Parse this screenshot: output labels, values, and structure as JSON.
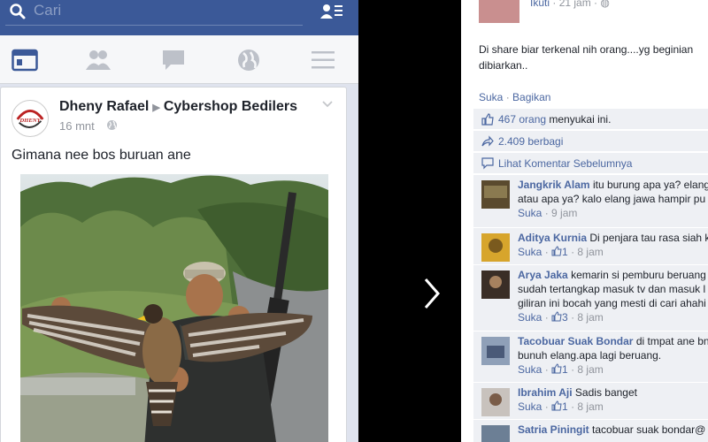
{
  "left": {
    "search": {
      "placeholder": "Cari"
    },
    "post": {
      "author": "Dheny Rafael",
      "target": "Cybershop Bedilers",
      "time": "16 mnt",
      "text": "Gimana nee bos buruan ane",
      "avatar_text": "DHENY"
    }
  },
  "right": {
    "header": {
      "poster": "Ikuti",
      "time": "21 jam"
    },
    "text": "Di share biar terkenal nih orang....yg beginian dibiarkan..",
    "actions": {
      "like": "Suka",
      "share": "Bagikan"
    },
    "likes": {
      "count": "467 orang",
      "suffix": "menyukai ini."
    },
    "shares": "2.409 berbagi",
    "previous": "Lihat Komentar Sebelumnya",
    "comments": [
      {
        "name": "Jangkrik Alam",
        "text": "itu burung apa ya? elang",
        "text2": "atau apa ya? kalo elang jawa hampir pu",
        "text3": "",
        "likes": "",
        "time": "9 jam"
      },
      {
        "name": "Aditya Kurnia",
        "text": "Di penjara tau rasa siah k",
        "text2": "",
        "text3": "",
        "likes": "1",
        "time": "8 jam"
      },
      {
        "name": "Arya Jaka",
        "text": "kemarin si pemburu beruang",
        "text2": "sudah tertangkap masuk tv dan masuk l",
        "text3": "giliran ini bocah yang mesti di cari ahahi",
        "likes": "3",
        "time": "8 jam"
      },
      {
        "name": "Tacobuar Suak Bondar",
        "text": "di tmpat ane bng",
        "text2": "bunuh elang.apa lagi beruang.",
        "text3": "",
        "likes": "1",
        "time": "8 jam"
      },
      {
        "name": "Ibrahim Aji",
        "text": "Sadis banget",
        "text2": "",
        "text3": "",
        "likes": "1",
        "time": "8 jam"
      },
      {
        "name": "Satria Piningit",
        "text": "tacobuar suak bondar@",
        "text2": "",
        "text3": "",
        "likes": "",
        "time": ""
      }
    ],
    "suka_label": "Suka"
  },
  "colors": {
    "brand": "#3b5998",
    "link": "#4b67a1",
    "meta": "#90949c"
  }
}
